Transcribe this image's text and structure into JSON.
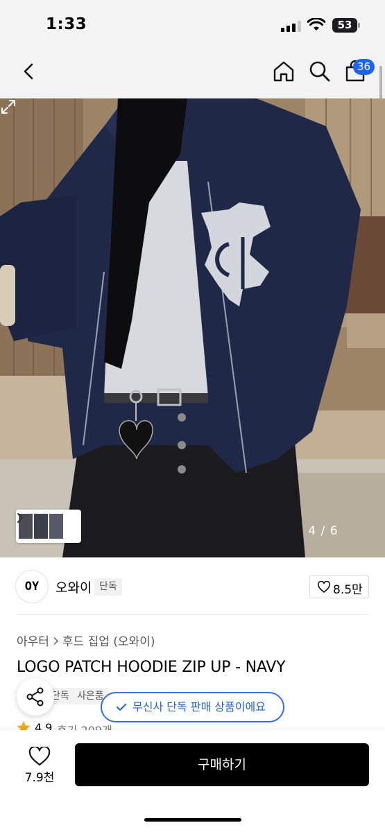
{
  "status_bar": {
    "time": "1:33",
    "battery": "53"
  },
  "nav": {
    "cart_count": "36"
  },
  "gallery": {
    "counter": "4 / 6",
    "current": 4,
    "total": 6
  },
  "brand": {
    "logo_text": "OY",
    "name": "오와이",
    "exclusive_tag": "단독",
    "likes": "8.5만"
  },
  "product": {
    "breadcrumb": [
      "아우터",
      "후드 집업 (오와이)"
    ],
    "title": "LOGO PATCH HOODIE ZIP UP - NAVY",
    "tags": [
      "단독",
      "사은품"
    ],
    "rating": "4.9",
    "reviews": "후기 209개"
  },
  "toast": {
    "text": "무신사 단독 판매 상품이에요"
  },
  "bottom_bar": {
    "likes": "7.9천",
    "buy_label": "구매하기"
  },
  "colors": {
    "accent_blue": "#1e63f5",
    "toast_blue": "#2f6ef3",
    "buy_button": "#000000",
    "star": "#f5a623"
  },
  "icons": [
    "back-arrow-icon",
    "home-icon",
    "search-icon",
    "cart-icon",
    "chevron-right-icon",
    "expand-icon",
    "heart-icon",
    "share-icon",
    "check-icon",
    "star-icon"
  ]
}
